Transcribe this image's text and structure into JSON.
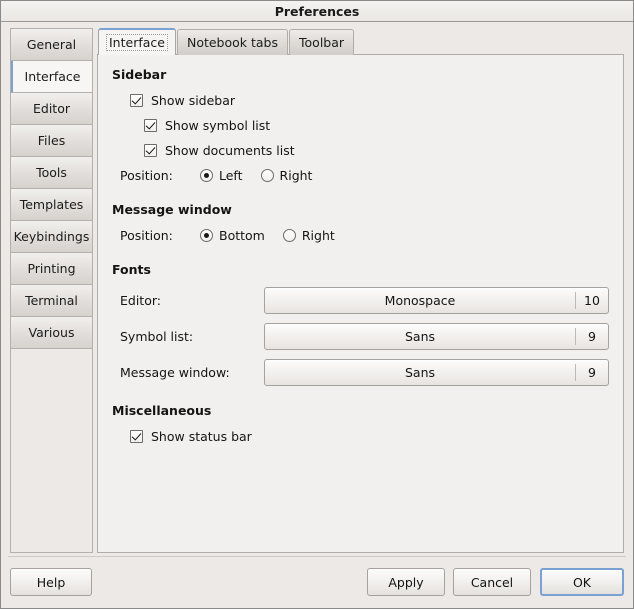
{
  "window": {
    "title": "Preferences"
  },
  "sidebar": {
    "items": [
      {
        "label": "General",
        "selected": false
      },
      {
        "label": "Interface",
        "selected": true
      },
      {
        "label": "Editor",
        "selected": false
      },
      {
        "label": "Files",
        "selected": false
      },
      {
        "label": "Tools",
        "selected": false
      },
      {
        "label": "Templates",
        "selected": false
      },
      {
        "label": "Keybindings",
        "selected": false
      },
      {
        "label": "Printing",
        "selected": false
      },
      {
        "label": "Terminal",
        "selected": false
      },
      {
        "label": "Various",
        "selected": false
      }
    ]
  },
  "notebook": {
    "tabs": [
      {
        "label": "Interface",
        "active": true
      },
      {
        "label": "Notebook tabs",
        "active": false
      },
      {
        "label": "Toolbar",
        "active": false
      }
    ]
  },
  "content": {
    "sidebar_group": {
      "title": "Sidebar",
      "show_sidebar": {
        "label": "Show sidebar",
        "checked": true
      },
      "show_symbol_list": {
        "label": "Show symbol list",
        "checked": true
      },
      "show_documents_list": {
        "label": "Show documents list",
        "checked": true
      },
      "position_label": "Position:",
      "position_left": {
        "label": "Left",
        "selected": true
      },
      "position_right": {
        "label": "Right",
        "selected": false
      }
    },
    "message_window_group": {
      "title": "Message window",
      "position_label": "Position:",
      "position_bottom": {
        "label": "Bottom",
        "selected": true
      },
      "position_right": {
        "label": "Right",
        "selected": false
      }
    },
    "fonts_group": {
      "title": "Fonts",
      "rows": [
        {
          "label": "Editor:",
          "font": "Monospace",
          "size": "10"
        },
        {
          "label": "Symbol list:",
          "font": "Sans",
          "size": "9"
        },
        {
          "label": "Message window:",
          "font": "Sans",
          "size": "9"
        }
      ]
    },
    "misc_group": {
      "title": "Miscellaneous",
      "show_status_bar": {
        "label": "Show status bar",
        "checked": true
      }
    }
  },
  "actions": {
    "help": "Help",
    "apply": "Apply",
    "cancel": "Cancel",
    "ok": "OK"
  },
  "colors": {
    "accent": "#7ba1d0",
    "window_bg": "#ece9e6",
    "page_bg": "#f2f0ee",
    "border": "#b0aca8"
  }
}
